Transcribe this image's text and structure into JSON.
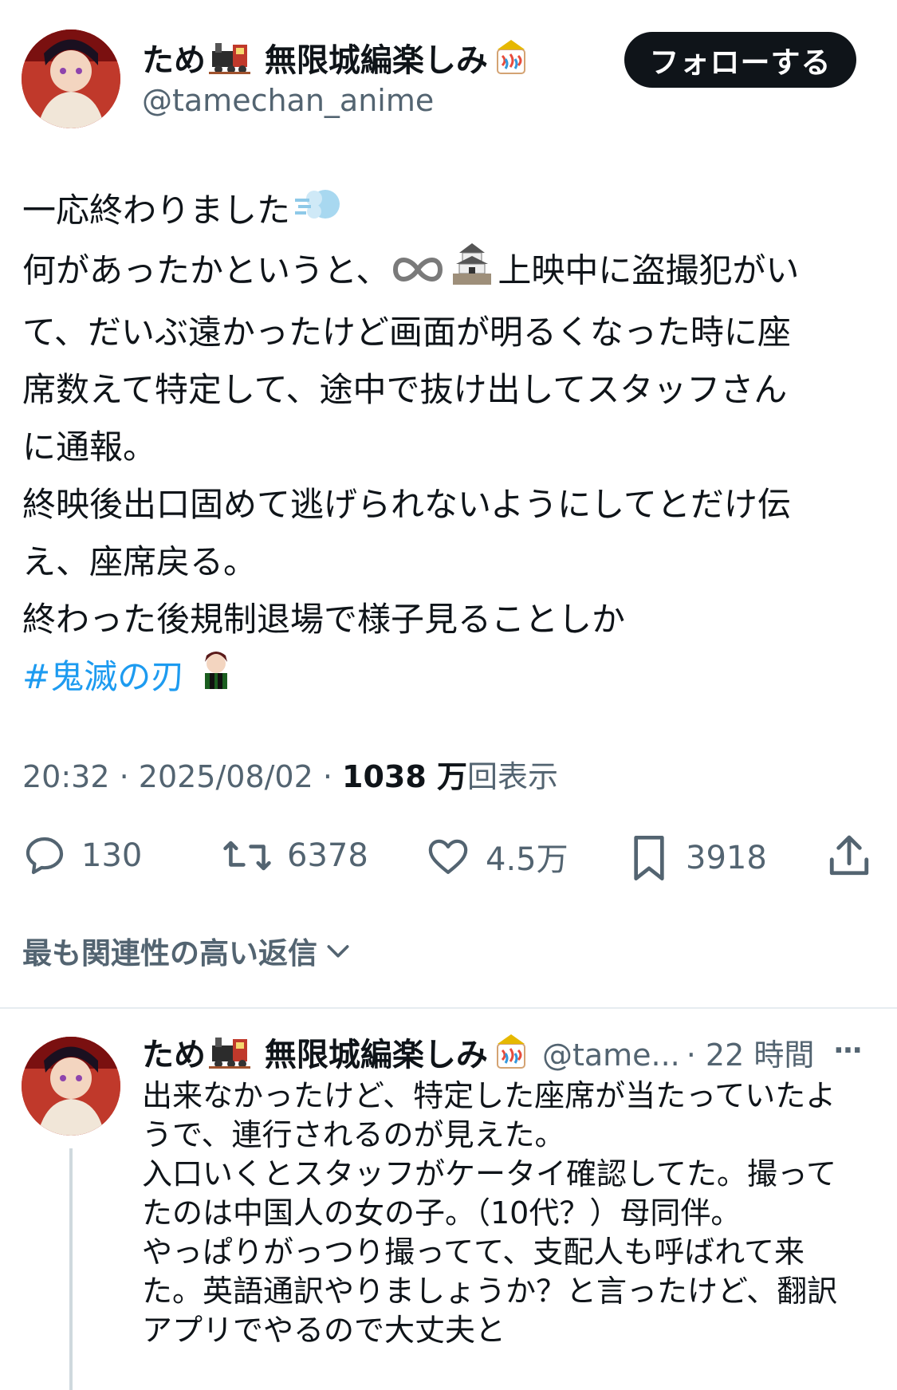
{
  "author": {
    "name_prefix": "ため",
    "name_suffix": " 無限城編楽しみ",
    "handle": "@tamechan_anime"
  },
  "follow_label": "フォローする",
  "tweet": {
    "line1": "一応終わりました",
    "line2_a": "何があったかというと、",
    "line2_b": "上映中に盗撮犯がい",
    "line3": "て、だいぶ遠かったけど画面が明るくなった時に座",
    "line4": "席数えて特定して、途中で抜け出してスタッフさん",
    "line5": "に通報。",
    "line6": "終映後出口固めて逃げられないようにしてとだけ伝",
    "line7": "え、座席戻る。",
    "line8": "終わった後規制退場で様子見ることしか",
    "hashtag": "#鬼滅の刃"
  },
  "meta": {
    "time": "20:32",
    "sep1": " · ",
    "date": "2025/08/02",
    "sep2": " · ",
    "views_number": "1038 万",
    "views_label": "回表示"
  },
  "actions": {
    "replies": "130",
    "retweets": "6378",
    "likes": "4.5万",
    "bookmarks": "3918"
  },
  "sort_label": "最も関連性の高い返信",
  "reply": {
    "name_prefix": "ため",
    "name_suffix": " 無限城編楽しみ",
    "handle": "@tame...",
    "time": "· 22 時間",
    "more": "···",
    "lines": [
      "出来なかったけど、特定した座席が当たっていたよ",
      "うで、連行されるのが見えた。",
      "入口いくとスタッフがケータイ確認してた。撮って",
      "たのは中国人の女の子。（10代？）母同伴。",
      "やっぱりがっつり撮ってて、支配人も呼ばれて来",
      "た。英語通訳やりましょうか？と言ったけど、翻訳",
      "アプリでやるので大丈夫と"
    ]
  },
  "colors": {
    "text": "#0f1419",
    "secondary": "#536471",
    "link": "#1d9bf0",
    "button_bg": "#0f1419"
  }
}
